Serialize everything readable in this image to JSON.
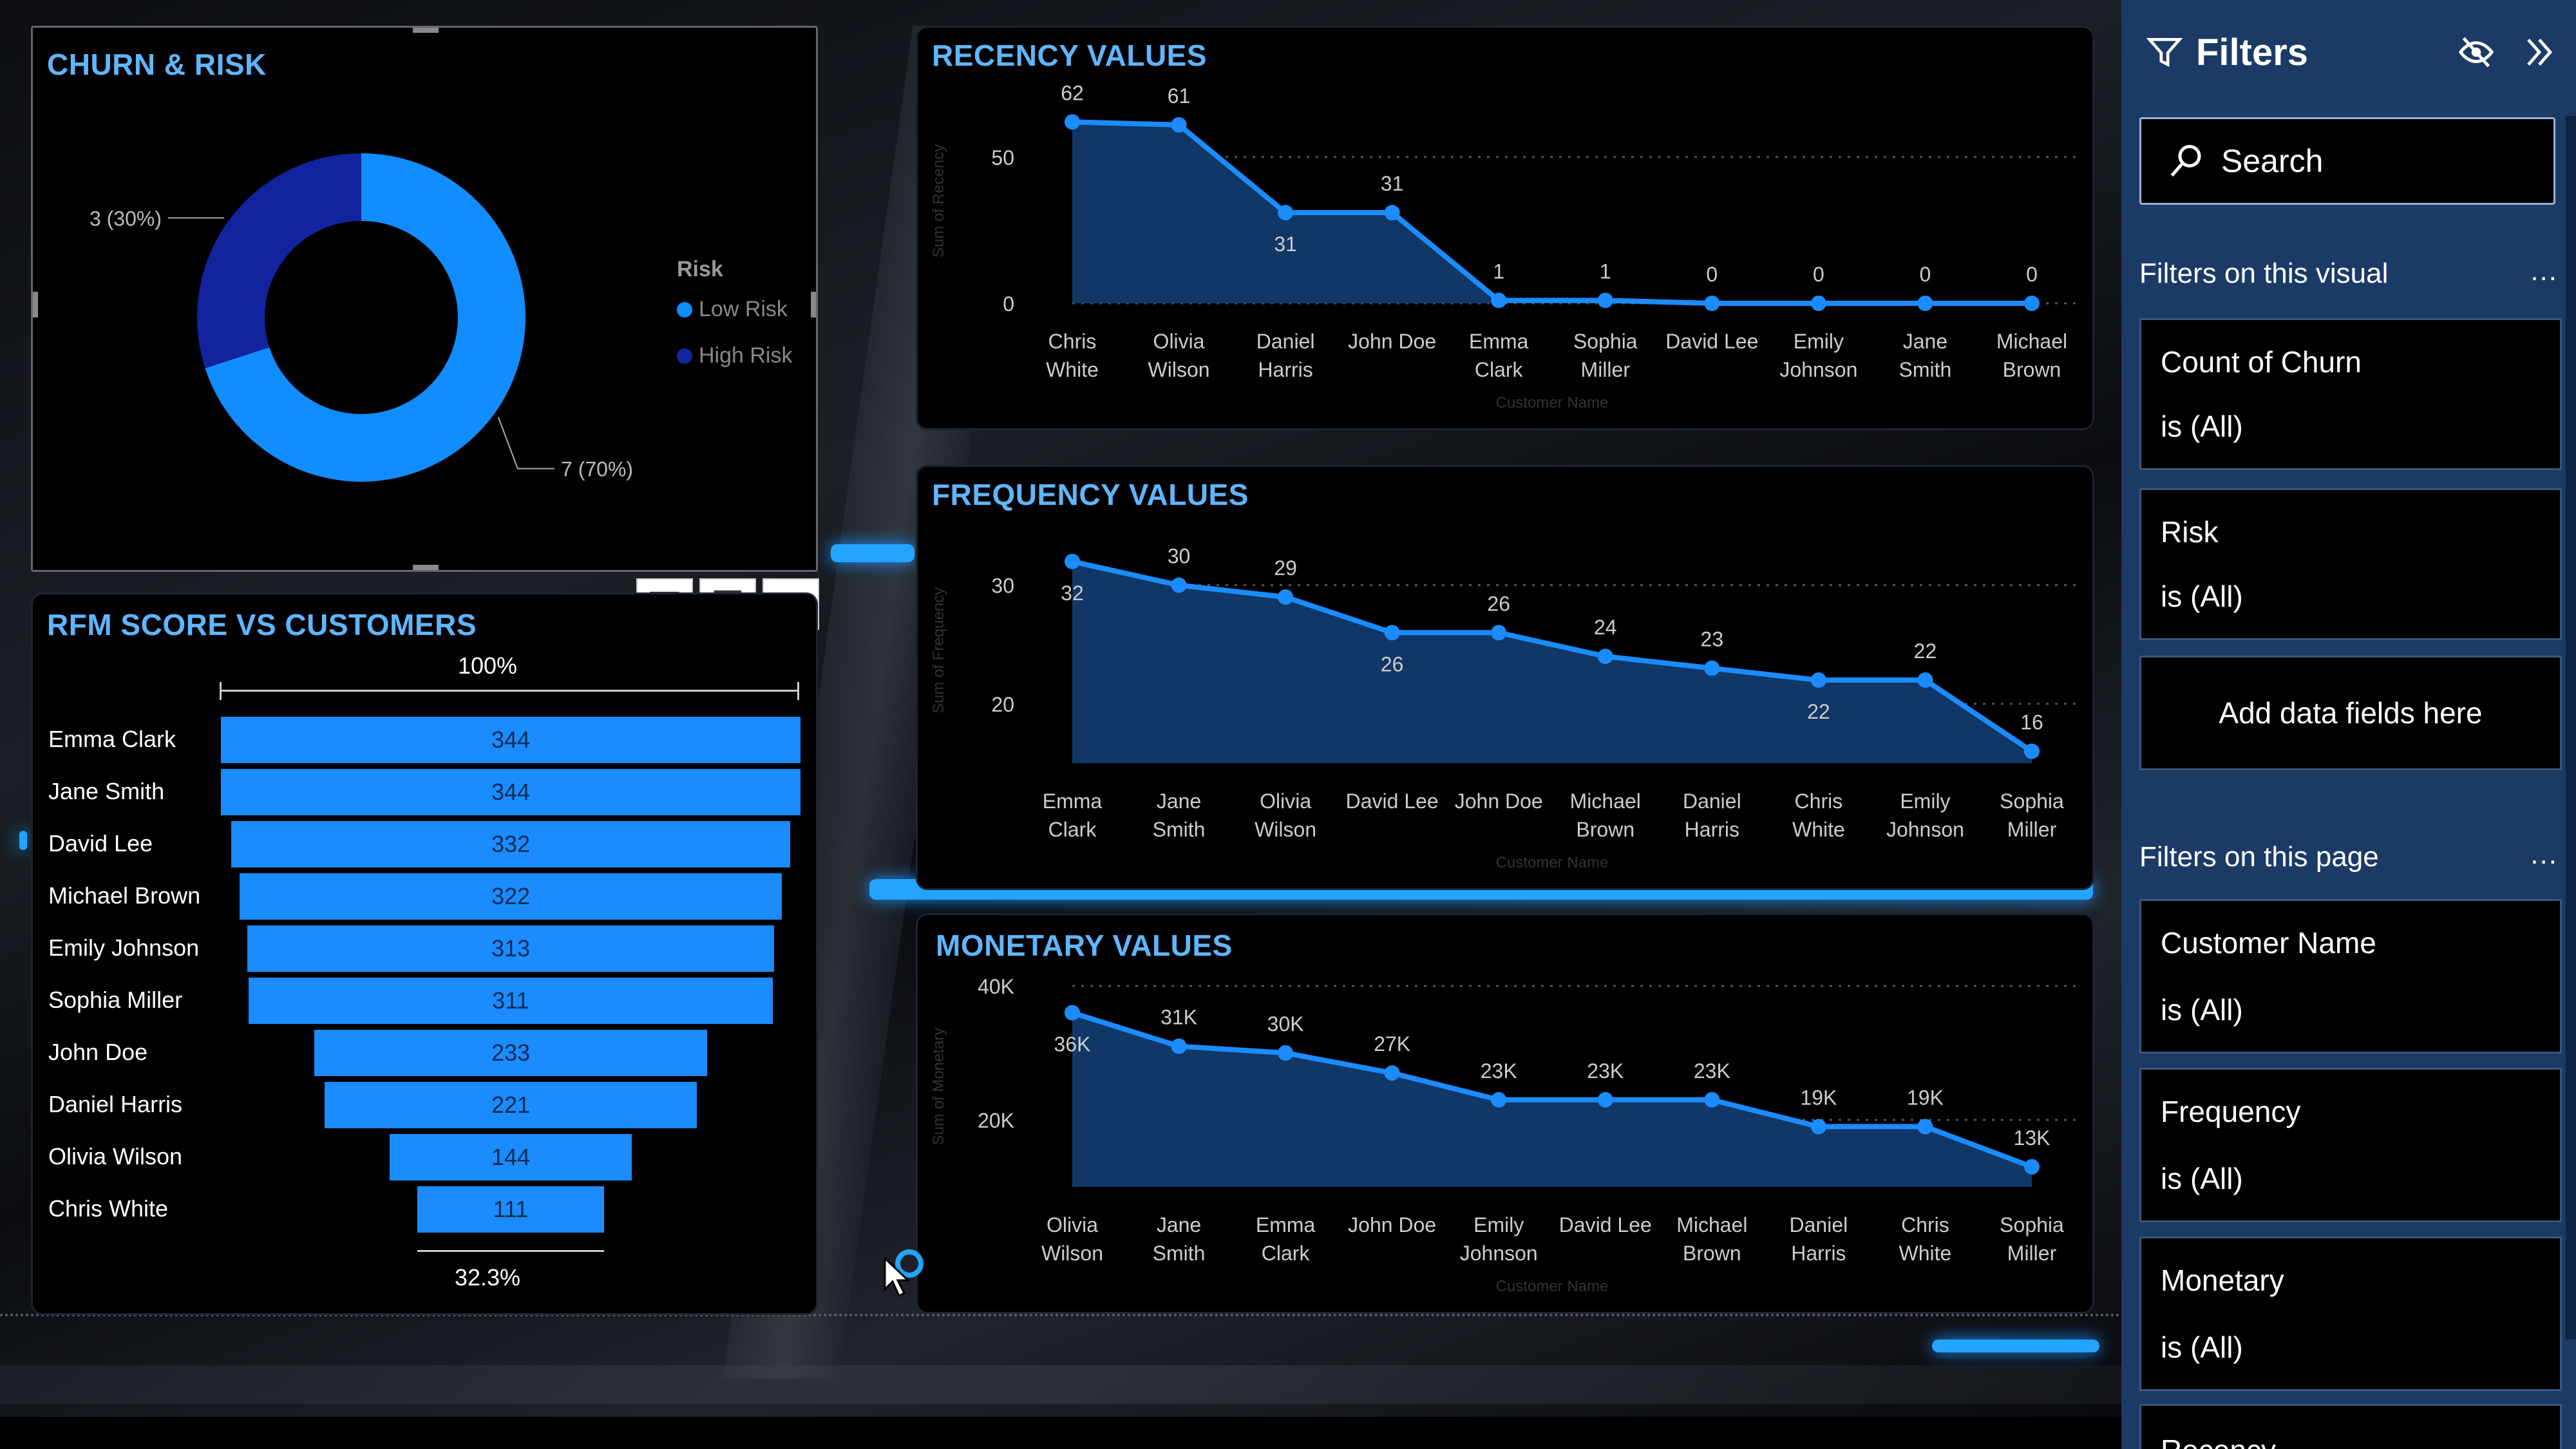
{
  "churn": {
    "title": "CHURN & RISK",
    "legend_title": "Risk",
    "legend": [
      {
        "label": "Low Risk",
        "color": "#118dff"
      },
      {
        "label": "High Risk",
        "color": "#12239e"
      }
    ],
    "slices": [
      {
        "label": "Low Risk",
        "value": 7,
        "text": "7 (70%)"
      },
      {
        "label": "High Risk",
        "value": 3,
        "text": "3 (30%)"
      }
    ]
  },
  "rfm": {
    "title": "RFM SCORE VS CUSTOMERS",
    "top_pct": "100%",
    "bottom_pct": "32.3%",
    "rows": [
      {
        "name": "Emma Clark",
        "value": 344
      },
      {
        "name": "Jane Smith",
        "value": 344
      },
      {
        "name": "David Lee",
        "value": 332
      },
      {
        "name": "Michael Brown",
        "value": 322
      },
      {
        "name": "Emily Johnson",
        "value": 313
      },
      {
        "name": "Sophia Miller",
        "value": 311
      },
      {
        "name": "John Doe",
        "value": 233
      },
      {
        "name": "Daniel Harris",
        "value": 221
      },
      {
        "name": "Olivia Wilson",
        "value": 144
      },
      {
        "name": "Chris White",
        "value": 111
      }
    ]
  },
  "chart_data": [
    {
      "type": "area",
      "title": "RECENCY VALUES",
      "xlabel": "Customer Name",
      "ylabel": "Sum of Recency",
      "categories": [
        "Chris\nWhite",
        "Olivia\nWilson",
        "Daniel\nHarris",
        "John Doe",
        "Emma\nClark",
        "Sophia\nMiller",
        "David Lee",
        "Emily\nJohnson",
        "Jane\nSmith",
        "Michael\nBrown"
      ],
      "values": [
        62,
        61,
        31,
        31,
        1,
        1,
        0,
        0,
        0,
        0
      ],
      "labels": [
        "62",
        "61",
        "31",
        "31",
        "1",
        "1",
        "0",
        "0",
        "0",
        "0"
      ],
      "label_pos": [
        "above",
        "above",
        "below",
        "above",
        "above",
        "above",
        "above",
        "above",
        "above",
        "above"
      ],
      "yticks": [
        {
          "v": 0,
          "t": "0"
        },
        {
          "v": 50,
          "t": "50"
        }
      ],
      "ylim": [
        0,
        70
      ]
    },
    {
      "type": "area",
      "title": "FREQUENCY VALUES",
      "xlabel": "Customer Name",
      "ylabel": "Sum of Frequency",
      "categories": [
        "Emma\nClark",
        "Jane\nSmith",
        "Olivia\nWilson",
        "David Lee",
        "John Doe",
        "Michael\nBrown",
        "Daniel\nHarris",
        "Chris\nWhite",
        "Emily\nJohnson",
        "Sophia\nMiller"
      ],
      "values": [
        32,
        30,
        29,
        26,
        26,
        24,
        23,
        22,
        22,
        16
      ],
      "labels": [
        "32",
        "30",
        "29",
        "26",
        "26",
        "24",
        "23",
        "22",
        "22",
        "16"
      ],
      "label_pos": [
        "below",
        "above",
        "above",
        "below",
        "above",
        "above",
        "above",
        "below",
        "above",
        "above"
      ],
      "yticks": [
        {
          "v": 20,
          "t": "20"
        },
        {
          "v": 30,
          "t": "30"
        }
      ],
      "ylim": [
        15,
        34
      ]
    },
    {
      "type": "area",
      "title": "MONETARY VALUES",
      "xlabel": "Customer Name",
      "ylabel": "Sum of Monetary",
      "categories": [
        "Olivia\nWilson",
        "Jane\nSmith",
        "Emma\nClark",
        "John Doe",
        "Emily\nJohnson",
        "David Lee",
        "Michael\nBrown",
        "Daniel\nHarris",
        "Chris\nWhite",
        "Sophia\nMiller"
      ],
      "values": [
        36000,
        31000,
        30000,
        27000,
        23000,
        23000,
        23000,
        19000,
        19000,
        13000
      ],
      "labels": [
        "36K",
        "31K",
        "30K",
        "27K",
        "23K",
        "23K",
        "23K",
        "19K",
        "19K",
        "13K"
      ],
      "label_pos": [
        "below",
        "above",
        "above",
        "above",
        "above",
        "above",
        "above",
        "above",
        "above",
        "above"
      ],
      "yticks": [
        {
          "v": 20000,
          "t": "20K"
        },
        {
          "v": 40000,
          "t": "40K"
        }
      ],
      "ylim": [
        10000,
        40000
      ]
    }
  ],
  "filters": {
    "title": "Filters",
    "search_placeholder": "Search",
    "visual_section": "Filters on this visual",
    "visual_cards": [
      {
        "name": "Count of Churn",
        "value": "is (All)"
      },
      {
        "name": "Risk",
        "value": "is (All)"
      }
    ],
    "add_fields": "Add data fields here",
    "page_section": "Filters on this page",
    "page_cards": [
      {
        "name": "Customer Name",
        "value": "is (All)"
      },
      {
        "name": "Frequency",
        "value": "is (All)"
      },
      {
        "name": "Monetary",
        "value": "is (All)"
      },
      {
        "name": "Recency",
        "value": ""
      }
    ],
    "more": "..."
  }
}
